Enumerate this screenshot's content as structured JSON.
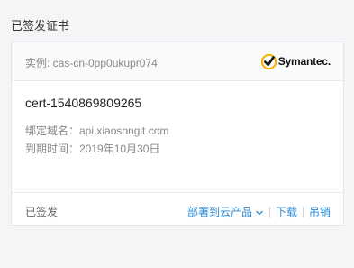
{
  "section": {
    "title": "已签发证书"
  },
  "card": {
    "instance_label": "实例: cas-cn-0pp0ukupr074",
    "brand": {
      "name": "Symantec.",
      "check_color": "#f5b400"
    },
    "cert_name": "cert-1540869809265",
    "bound_domain": "绑定域名：api.xiaosongit.com",
    "expiry": "到期时间：2019年10月30日",
    "status": "已签发",
    "actions": {
      "deploy": "部署到云产品",
      "download": "下载",
      "revoke": "吊销"
    }
  },
  "colors": {
    "link": "#2a8bd5",
    "muted": "#888888",
    "background": "#f4f5f7"
  }
}
